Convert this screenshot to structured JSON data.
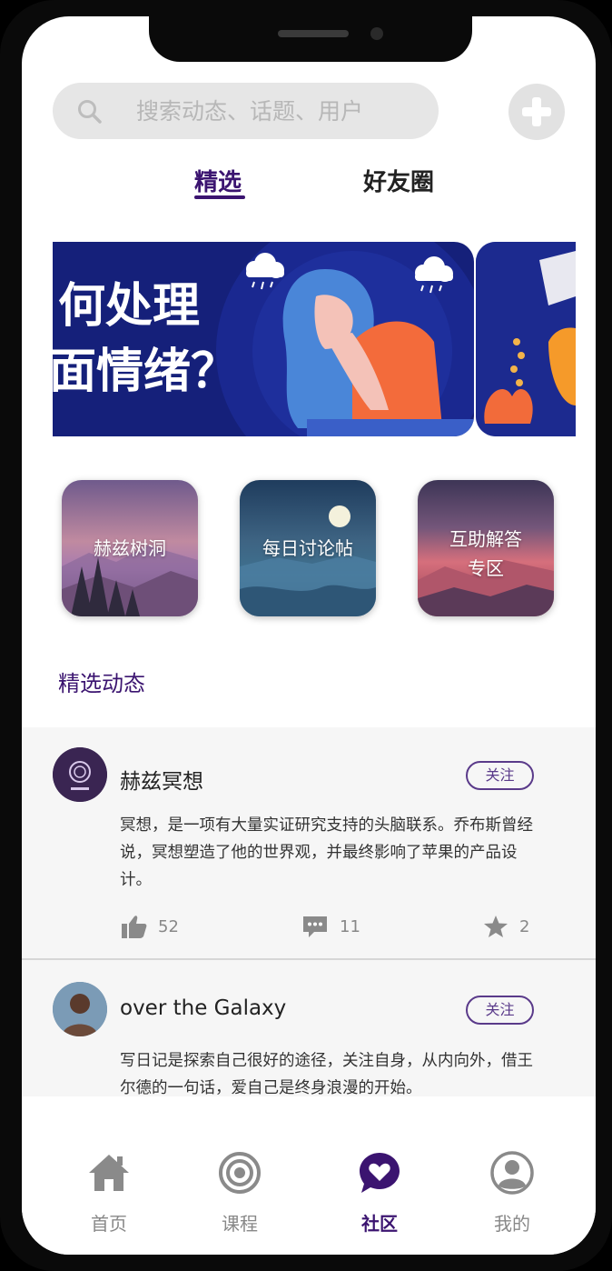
{
  "search": {
    "placeholder": "搜索动态、话题、用户"
  },
  "tabs": [
    {
      "label": "精选",
      "active": true
    },
    {
      "label": "好友圈",
      "active": false
    }
  ],
  "banner": {
    "line1": "何处理",
    "line2": "面情绪？"
  },
  "categories": [
    {
      "label": "赫兹树洞"
    },
    {
      "label_line1": "每日讨论帖"
    },
    {
      "label_line1": "互助解答",
      "label_line2": "专区"
    }
  ],
  "section_title": "精选动态",
  "posts": [
    {
      "author": "赫兹冥想",
      "follow_label": "关注",
      "text": "冥想，是一项有大量实证研究支持的头脑联系。乔布斯曾经说，冥想塑造了他的世界观，并最终影响了苹果的产品设计。",
      "likes": "52",
      "comments": "11",
      "stars": "2"
    },
    {
      "author": "over the Galaxy",
      "follow_label": "关注",
      "text": "写日记是探索自己很好的途径，关注自身，从内向外，借王尔德的一句话，爱自己是终身浪漫的开始。"
    }
  ],
  "nav": [
    {
      "label": "首页",
      "icon": "home-icon"
    },
    {
      "label": "课程",
      "icon": "target-icon"
    },
    {
      "label": "社区",
      "icon": "heart-chat-icon",
      "active": true
    },
    {
      "label": "我的",
      "icon": "user-icon"
    }
  ],
  "colors": {
    "accent": "#3b1470",
    "feed_bg": "#f6f6f6",
    "banner_bg": "#15207a"
  }
}
